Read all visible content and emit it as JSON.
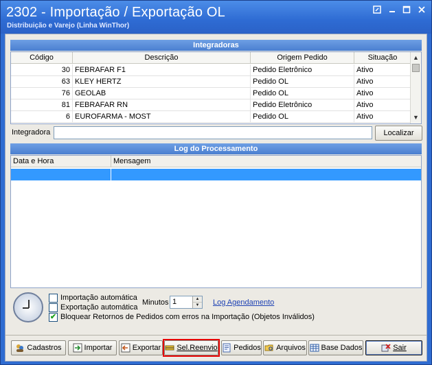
{
  "window": {
    "title": "2302 - Importação / Exportação OL",
    "subtitle": "Distribuição e Varejo (Linha WinThor)"
  },
  "integradoras": {
    "header": "Integradoras",
    "columns": [
      "Código",
      "Descrição",
      "Origem Pedido",
      "Situação"
    ],
    "rows": [
      {
        "codigo": "30",
        "descricao": "FEBRAFAR F1",
        "origem": "Pedido Eletrônico",
        "situacao": "Ativo"
      },
      {
        "codigo": "63",
        "descricao": "KLEY HERTZ",
        "origem": "Pedido OL",
        "situacao": "Ativo"
      },
      {
        "codigo": "76",
        "descricao": "GEOLAB",
        "origem": "Pedido OL",
        "situacao": "Ativo"
      },
      {
        "codigo": "81",
        "descricao": "FEBRAFAR RN",
        "origem": "Pedido Eletrônico",
        "situacao": "Ativo"
      },
      {
        "codigo": "6",
        "descricao": "EUROFARMA - MOST",
        "origem": "Pedido OL",
        "situacao": "Ativo"
      }
    ],
    "search_label": "Integradora",
    "search_value": "",
    "search_button": "Localizar"
  },
  "log": {
    "header": "Log do Processamento",
    "columns": [
      "Data e Hora",
      "Mensagem"
    ]
  },
  "options": {
    "import_auto_label": "Importação automática",
    "import_auto_checked": false,
    "export_auto_label": "Exportação automática",
    "export_auto_checked": false,
    "block_label": "Bloquear Retornos de Pedidos com erros na Importação (Objetos Inválidos)",
    "block_checked": true,
    "minutes_label": "Minutos",
    "minutes_value": "1",
    "log_link": "Log Agendamento"
  },
  "toolbar": {
    "cadastros": "Cadastros",
    "importar": "Importar",
    "exportar": "Exportar",
    "sel_reenvio": "Sel.Reenvio",
    "pedidos": "Pedidos",
    "arquivos": "Arquivos",
    "base_dados": "Base Dados",
    "sair": "Sair"
  },
  "colors": {
    "title_bar": "#2e6bd3",
    "panel_header": "#5a8cd8",
    "selected_row": "#3399ff",
    "highlight": "#e60000"
  },
  "icons": [
    "restore-icon",
    "minimize-icon",
    "maximize-icon",
    "close-icon",
    "clock-icon"
  ]
}
